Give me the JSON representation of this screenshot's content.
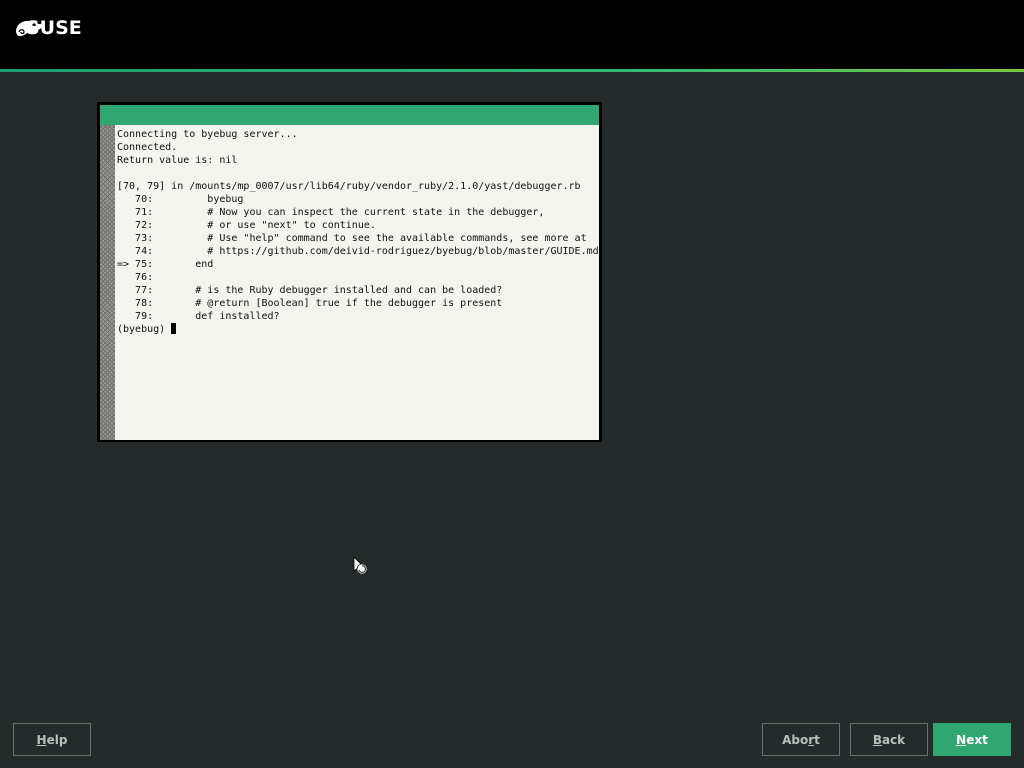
{
  "header": {
    "logo_text": "SUSE",
    "accent_color": "#30ba78"
  },
  "terminal": {
    "lines": [
      "Connecting to byebug server...",
      "Connected.",
      "Return value is: nil",
      "",
      "[70, 79] in /mounts/mp_0007/usr/lib64/ruby/vendor_ruby/2.1.0/yast/debugger.rb",
      "   70:         byebug",
      "   71:         # Now you can inspect the current state in the debugger,",
      "   72:         # or use \"next\" to continue.",
      "   73:         # Use \"help\" command to see the available commands, see more at",
      "   74:         # https://github.com/deivid-rodriguez/byebug/blob/master/GUIDE.md",
      "=> 75:       end",
      "   76:",
      "   77:       # is the Ruby debugger installed and can be loaded?",
      "   78:       # @return [Boolean] true if the debugger is present",
      "   79:       def installed?"
    ],
    "prompt": "(byebug) "
  },
  "buttons": {
    "help": {
      "mnemonic": "H",
      "rest": "elp"
    },
    "abort": {
      "before": "Abo",
      "mnemonic": "r",
      "after": "t"
    },
    "back": {
      "mnemonic": "B",
      "rest": "ack"
    },
    "next": {
      "mnemonic": "N",
      "rest": "ext"
    }
  }
}
